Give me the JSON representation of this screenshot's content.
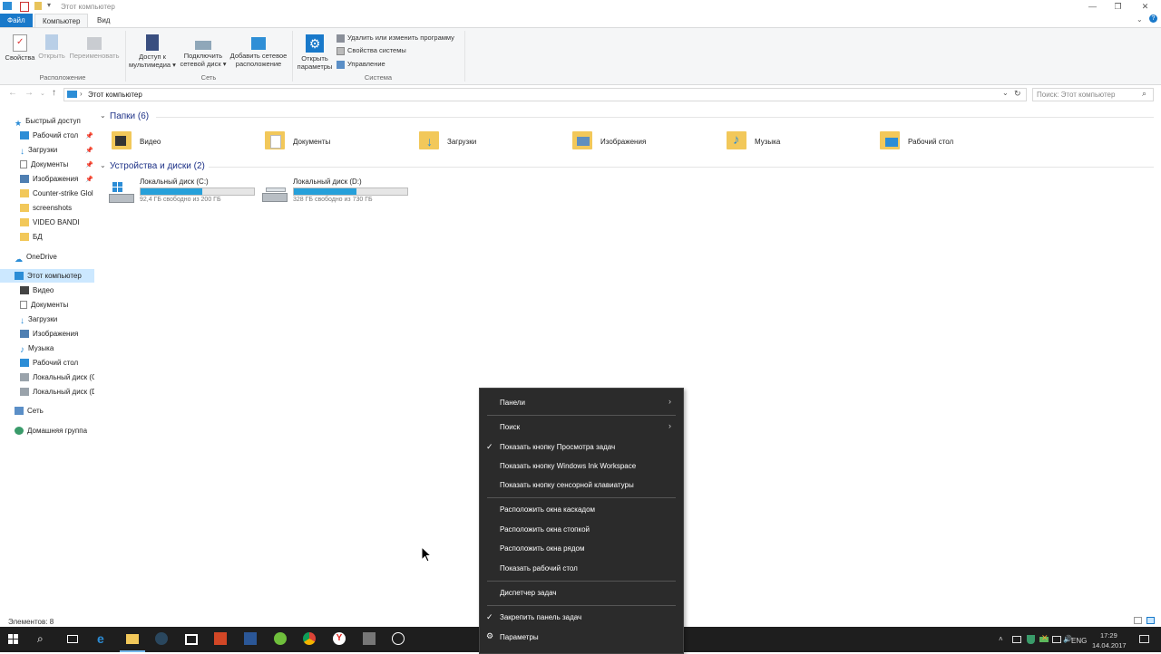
{
  "window": {
    "title": "Этот компьютер",
    "tabs": [
      "Файл",
      "Компьютер",
      "Вид"
    ]
  },
  "ribbon": {
    "location_group": {
      "label": "Расположение",
      "buttons": [
        "Свойства",
        "Открыть",
        "Переименовать"
      ]
    },
    "network_group": {
      "label": "Сеть",
      "buttons": [
        {
          "l1": "Доступ к",
          "l2": "мультимедиа ▾"
        },
        {
          "l1": "Подключить",
          "l2": "сетевой диск ▾"
        },
        {
          "l1": "Добавить сетевое",
          "l2": "расположение"
        }
      ]
    },
    "system_group": {
      "label": "Система",
      "open_settings": {
        "l1": "Открыть",
        "l2": "параметры"
      },
      "items": [
        "Удалить или изменить программу",
        "Свойства системы",
        "Управление"
      ]
    }
  },
  "address": {
    "path": "Этот компьютер",
    "search_placeholder": "Поиск: Этот компьютер"
  },
  "nav": {
    "quick_access": "Быстрый доступ",
    "quick_items": [
      "Рабочий стол",
      "Загрузки",
      "Документы",
      "Изображения",
      "Counter-strike Glol",
      "screenshots",
      "VIDEO BANDI",
      "БД"
    ],
    "onedrive": "OneDrive",
    "this_pc": "Этот компьютер",
    "pc_items": [
      "Видео",
      "Документы",
      "Загрузки",
      "Изображения",
      "Музыка",
      "Рабочий стол",
      "Локальный диск (C",
      "Локальный диск (D"
    ],
    "network": "Сеть",
    "homegroup": "Домашняя группа"
  },
  "content": {
    "folders_header": "Папки (6)",
    "folders": [
      "Видео",
      "Документы",
      "Загрузки",
      "Изображения",
      "Музыка",
      "Рабочий стол"
    ],
    "drives_header": "Устройства и диски (2)",
    "drives": [
      {
        "name": "Локальный диск (C:)",
        "free": "92,4 ГБ свободно из 200 ГБ",
        "used_fraction": 0.54
      },
      {
        "name": "Локальный диск (D:)",
        "free": "328 ГБ свободно из 730 ГБ",
        "used_fraction": 0.55
      }
    ]
  },
  "status": {
    "items": "Элементов: 8"
  },
  "context_menu": {
    "items": [
      {
        "label": "Панели",
        "submenu": true
      },
      {
        "label": "Поиск",
        "submenu": true
      },
      {
        "label": "Показать кнопку Просмотра задач",
        "checked": true
      },
      {
        "label": "Показать кнопку Windows Ink Workspace"
      },
      {
        "label": "Показать кнопку сенсорной клавиатуры"
      },
      {
        "label": "Расположить окна каскадом"
      },
      {
        "label": "Расположить окна стопкой"
      },
      {
        "label": "Расположить окна рядом"
      },
      {
        "label": "Показать рабочий стол"
      },
      {
        "label": "Диспетчер задач"
      },
      {
        "label": "Закрепить панель задач",
        "checked": true
      },
      {
        "label": "Параметры",
        "icon": "gear-icon"
      }
    ]
  },
  "taskbar": {
    "lang": "ENG",
    "time": "17:29",
    "date": "14.04.2017"
  },
  "colors": {
    "accent": "#1979ca",
    "folder": "#f2c85a",
    "drive_fill": "#26a0da",
    "menu_bg": "#2b2b2b",
    "taskbar_bg": "#1e1e1e"
  }
}
